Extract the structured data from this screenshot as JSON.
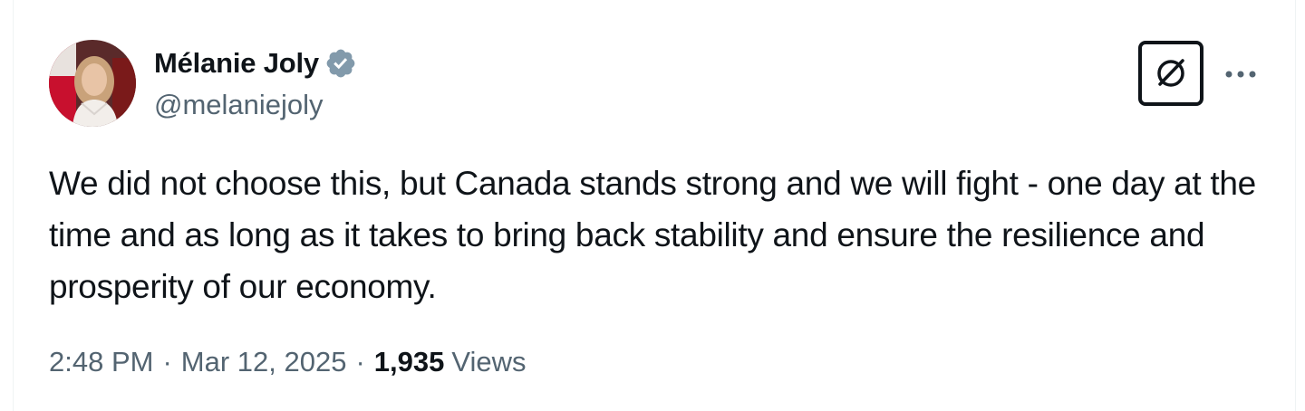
{
  "author": {
    "display_name": "Mélanie Joly",
    "handle": "@melaniejoly",
    "avatar_icon": "profile-photo",
    "verified_icon": "verified-badge-icon",
    "verified_color": "#829aab"
  },
  "actions": {
    "grok_icon": "grok-icon",
    "more_icon": "more-horizontal-icon"
  },
  "tweet": {
    "text": "We did not choose this, but Canada stands strong and we will fight - one day at the time and as long as it takes to bring back stability and ensure the resilience and prosperity of our economy."
  },
  "meta": {
    "time": "2:48 PM",
    "date": "Mar 12, 2025",
    "separator": "·",
    "views_count": "1,935",
    "views_label": "Views"
  },
  "colors": {
    "text_primary": "#0f1419",
    "text_secondary": "#536471",
    "border": "#eff3f4"
  }
}
